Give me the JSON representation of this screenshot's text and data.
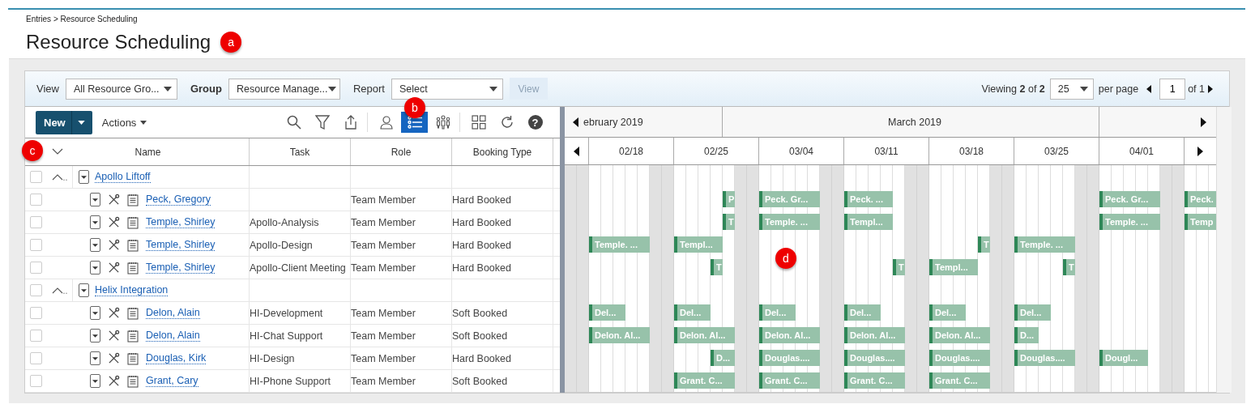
{
  "breadcrumb": "Entries > Resource Scheduling",
  "title": "Resource Scheduling",
  "title_callout": "a",
  "filters": [
    {
      "label": "View",
      "value": "All Resource Gro...",
      "bold": false
    },
    {
      "label": "Group",
      "value": "Resource Manage...",
      "bold": true
    },
    {
      "label": "Report",
      "value": "Select",
      "bold": false
    }
  ],
  "view_button": {
    "label": "View",
    "disabled": true
  },
  "pagination": {
    "viewing": "Viewing **2** of **2**",
    "per_page": "25",
    "per_page_label": "per page",
    "page": "1",
    "of": "of 1"
  },
  "toolbar": {
    "new": "New",
    "actions": "Actions",
    "tools": [
      {
        "kind": "search",
        "selected": false
      },
      {
        "kind": "filter",
        "selected": false
      },
      {
        "kind": "export",
        "selected": false
      },
      {
        "kind": "user",
        "selected": false
      },
      {
        "kind": "list",
        "selected": true,
        "callout": "b"
      },
      {
        "kind": "people",
        "selected": false
      },
      {
        "kind": "grid",
        "selected": false
      },
      {
        "kind": "refresh",
        "selected": false
      },
      {
        "kind": "help",
        "selected": false,
        "glyph": "?"
      }
    ]
  },
  "columns": [
    "Name",
    "Task",
    "Role",
    "Booking Type"
  ],
  "header_callout": "c",
  "groups": [
    {
      "name": "Apollo Liftoff",
      "expanded": true,
      "checked": false,
      "rows": [
        {
          "name": "Peck, Gregory",
          "role": "Team Member",
          "booking": "Hard Booked",
          "checked": false,
          "bars": [
            "P",
            "Peck. Gr...",
            "Peck. ...",
            "Peck. Gr...",
            "Peck."
          ]
        },
        {
          "name": "Temple, Shirley",
          "task": "Apollo-Analysis",
          "role": "Team Member",
          "booking": "Hard Booked",
          "checked": false,
          "bars": [
            "T",
            "Temple. ...",
            "Templ...",
            "Temple. ...",
            "Temp"
          ]
        },
        {
          "name": "Temple, Shirley",
          "task": "Apollo-Design",
          "role": "Team Member",
          "booking": "Hard Booked",
          "checked": false,
          "bars": [
            "Temple. ...",
            "Templ...",
            "T",
            "Temple. ..."
          ]
        },
        {
          "name": "Temple, Shirley",
          "task": "Apollo-Client Meeting",
          "role": "Team Member",
          "booking": "Hard Booked",
          "checked": false,
          "bars": [
            "T",
            "T",
            "Templ...",
            "T"
          ]
        }
      ]
    },
    {
      "name": "Helix Integration",
      "expanded": true,
      "checked": false,
      "rows": [
        {
          "name": "Delon, Alain",
          "task": "HI-Development",
          "role": "Team Member",
          "booking": "Soft Booked",
          "checked": false,
          "bars": [
            "Del...",
            "Del...",
            "Del...",
            "Del...",
            "Del...",
            "Del..."
          ]
        },
        {
          "name": "Delon, Alain",
          "task": "HI-Chat Support",
          "role": "Team Member",
          "booking": "Soft Booked",
          "checked": false,
          "bars": [
            "Delon. Al...",
            "Delon. Al...",
            "Delon. Al...",
            "Delon. Al...",
            "Delon. Al...",
            "D..."
          ]
        },
        {
          "name": "Douglas, Kirk",
          "task": "HI-Design",
          "role": "Team Member",
          "booking": "Hard Booked",
          "checked": false,
          "bars": [
            "D...",
            "Douglas....",
            "Douglas....",
            "Douglas....",
            "Douglas....",
            "Dougl..."
          ]
        },
        {
          "name": "Grant, Cary",
          "task": "HI-Phone Support",
          "role": "Team Member",
          "booking": "Soft Booked",
          "checked": false,
          "bars": [
            "Grant. C...",
            "Grant. C...",
            "Grant. C...",
            "Grant. C..."
          ]
        }
      ]
    }
  ],
  "timeline": {
    "months": [
      "ebruary 2019",
      "March 2019"
    ],
    "weeks": [
      "02/18",
      "02/25",
      "03/04",
      "03/11",
      "03/18",
      "03/25",
      "04/01"
    ],
    "callout": "d"
  }
}
